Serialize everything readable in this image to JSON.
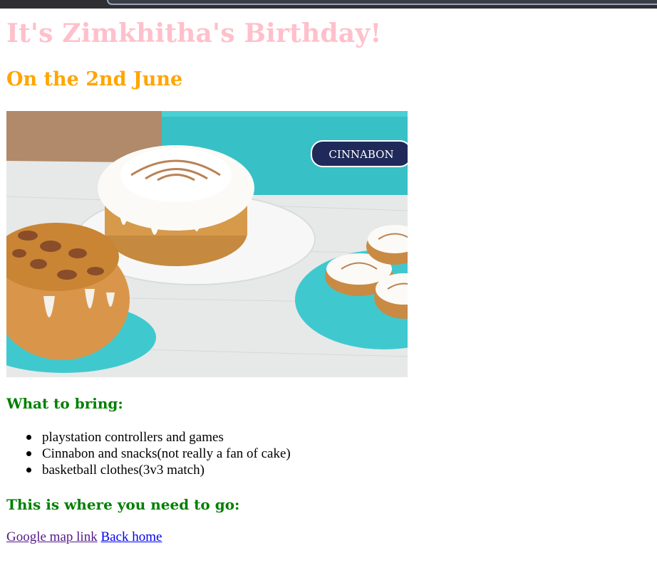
{
  "page": {
    "title": "It's Zimkhitha's Birthday!",
    "date_heading": "On the 2nd June",
    "hero_image": {
      "brand_text": "CINNABON"
    },
    "bring_heading": "What to bring:",
    "bring_items": [
      "playstation controllers and games",
      "Cinnabon and snacks(not really a fan of cake)",
      "basketball clothes(3v3 match)"
    ],
    "go_heading": "This is where you need to go:",
    "links": {
      "map": "Google map link",
      "home": "Back home"
    }
  },
  "colors": {
    "title": "#ffc0cb",
    "date_heading": "#ffa500",
    "section_heading": "#008000",
    "link_visited": "#551a8b",
    "link": "#0000ee"
  },
  "icons": {
    "bullet": "filled-circle"
  }
}
